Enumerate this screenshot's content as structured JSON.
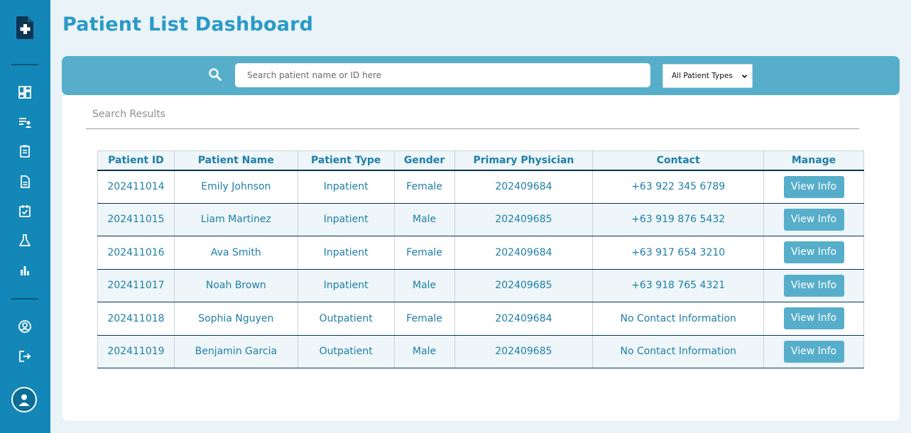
{
  "page": {
    "title": "Patient List Dashboard"
  },
  "search": {
    "placeholder": "Search patient name or ID here",
    "type_filter": "All Patient Types"
  },
  "results": {
    "label": "Search Results"
  },
  "table": {
    "headers": {
      "id": "Patient ID",
      "name": "Patient Name",
      "type": "Patient Type",
      "gender": "Gender",
      "physician": "Primary Physician",
      "contact": "Contact",
      "manage": "Manage"
    },
    "action_label": "View Info",
    "rows": [
      {
        "id": "202411014",
        "name": "Emily Johnson",
        "type": "Inpatient",
        "gender": "Female",
        "physician": "202409684",
        "contact": "+63 922 345 6789"
      },
      {
        "id": "202411015",
        "name": "Liam Martinez",
        "type": "Inpatient",
        "gender": "Male",
        "physician": "202409685",
        "contact": "+63 919 876 5432"
      },
      {
        "id": "202411016",
        "name": "Ava Smith",
        "type": "Inpatient",
        "gender": "Female",
        "physician": "202409684",
        "contact": "+63 917 654 3210"
      },
      {
        "id": "202411017",
        "name": "Noah Brown",
        "type": "Inpatient",
        "gender": "Male",
        "physician": "202409685",
        "contact": "+63 918 765 4321"
      },
      {
        "id": "202411018",
        "name": "Sophia Nguyen",
        "type": "Outpatient",
        "gender": "Female",
        "physician": "202409684",
        "contact": "No Contact Information"
      },
      {
        "id": "202411019",
        "name": "Benjamin Garcia",
        "type": "Outpatient",
        "gender": "Male",
        "physician": "202409685",
        "contact": "No Contact Information"
      }
    ]
  },
  "sidebar": {
    "icons": [
      "dashboard-icon",
      "patient-list-icon",
      "clipboard-icon",
      "document-icon",
      "checklist-icon",
      "lab-flask-icon",
      "bar-chart-icon",
      "user-circle-icon",
      "logout-icon",
      "avatar-icon"
    ]
  },
  "colors": {
    "sidebar": "#1287b8",
    "accent": "#2a9ac6",
    "search_band": "#57aecb",
    "button": "#57aecb",
    "text": "#1f7ea6"
  }
}
